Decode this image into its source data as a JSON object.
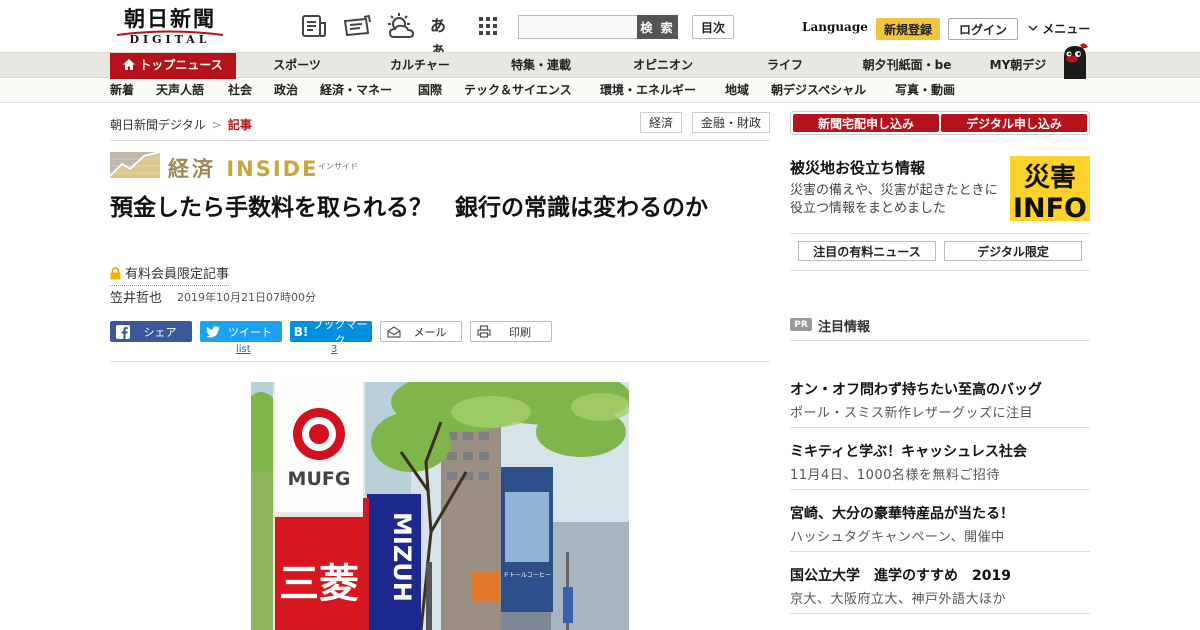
{
  "header": {
    "logo_main": "朝日新聞",
    "logo_sub": "DIGITAL",
    "search_button": "検 索",
    "toc_button": "目次",
    "font_size_icon_text": "あぁ",
    "language": "Language",
    "register": "新規登録",
    "login": "ログイン",
    "menu": "メニュー"
  },
  "primary_nav": [
    "トップニュース",
    "スポーツ",
    "カルチャー",
    "特集・連載",
    "オピニオン",
    "ライフ",
    "朝夕刊紙面・be",
    "MY朝デジ"
  ],
  "secondary_nav": [
    "新着",
    "天声人語",
    "社会",
    "政治",
    "経済・マネー",
    "国際",
    "テック＆サイエンス",
    "環境・エネルギー",
    "地域",
    "朝デジスペシャル",
    "写真・動画"
  ],
  "breadcrumb": {
    "home": "朝日新聞デジタル",
    "separator": ">",
    "current": "記事"
  },
  "tags": [
    "経済",
    "金融・財政"
  ],
  "article": {
    "series_name": "経済",
    "series_name_en": "INSIDE",
    "series_sub": "インサイド",
    "headline": "預金したら手数料を取られる？　銀行の常識は変わるのか",
    "paid_label": "有料会員限定記事",
    "author": "笠井哲也",
    "date": "2019年10月21日07時00分"
  },
  "share": {
    "facebook": "シェア",
    "twitter": "ツイート",
    "hatena": "ブックマーク",
    "hatena_icon": "B!",
    "mail": "メール",
    "print": "印刷",
    "twitter_count": "list",
    "hatena_count": "3"
  },
  "photo": {
    "sign_mufg": "MUFG",
    "sign_kanji": "三菱",
    "sign_mizuho": "MIZUH",
    "building_sign": "ドトールコーヒー"
  },
  "sidebar": {
    "subscribe_newspaper": "新聞宅配申し込み",
    "subscribe_digital": "デジタル申し込み",
    "disaster_title": "被災地お役立ち情報",
    "disaster_desc": "災害の備えや、災害が起きたときに役立つ情報をまとめました",
    "disaster_banner_top": "災害",
    "disaster_banner_bottom": "INFO",
    "paid_news_button": "注目の有料ニュース",
    "digital_only_button": "デジタル限定",
    "pr_badge": "PR",
    "pr_heading": "注目情報",
    "pr_items": [
      {
        "title": "オン・オフ問わず持ちたい至高のバッグ",
        "sub": "ポール・スミス新作レザーグッズに注目"
      },
      {
        "title": "ミキティと学ぶ！キャッシュレス社会",
        "sub": "11月4日、1000名様を無料ご招待"
      },
      {
        "title": "宮崎、大分の豪華特産品が当たる！",
        "sub": "ハッシュタグキャンペーン、開催中"
      },
      {
        "title": "国公立大学　進学のすすめ　2019",
        "sub": "京大、大阪府立大、神戸外語大ほか"
      }
    ]
  },
  "colors": {
    "brand_red": "#b5121b",
    "register_yellow": "#f3c53f",
    "facebook": "#3b5998",
    "twitter": "#1da1f2",
    "hatena": "#008fde",
    "disaster_yellow": "#fdd22a"
  }
}
